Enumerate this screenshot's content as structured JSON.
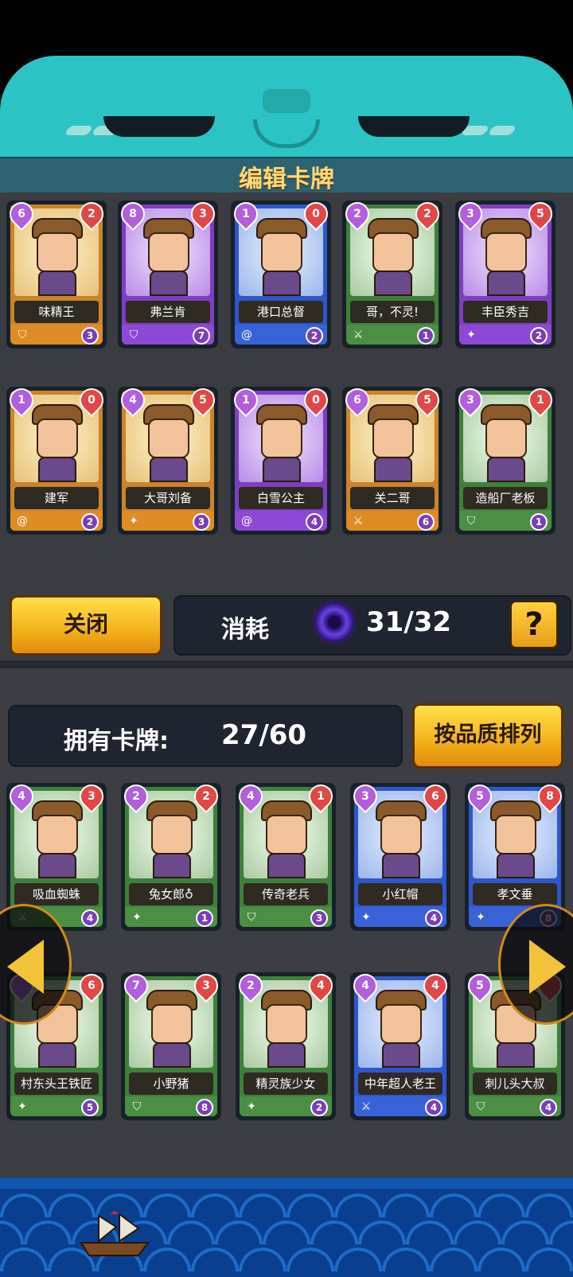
{
  "header": {
    "title": "编辑卡牌"
  },
  "deck": {
    "cards": [
      {
        "name": "味精王",
        "cost": "6",
        "attack": "2",
        "level": "3",
        "rarity": "orange",
        "type_icon": "shield-icon"
      },
      {
        "name": "弗兰肯",
        "cost": "8",
        "attack": "3",
        "level": "7",
        "rarity": "purple",
        "type_icon": "shield-icon"
      },
      {
        "name": "港口总督",
        "cost": "1",
        "attack": "0",
        "level": "2",
        "rarity": "blue",
        "type_icon": "swirl-icon"
      },
      {
        "name": "哥，不灵!",
        "cost": "2",
        "attack": "2",
        "level": "1",
        "rarity": "green",
        "type_icon": "sword-icon"
      },
      {
        "name": "丰臣秀吉",
        "cost": "3",
        "attack": "5",
        "level": "2",
        "rarity": "purple",
        "type_icon": "shuriken-icon"
      },
      {
        "name": "建军",
        "cost": "1",
        "attack": "0",
        "level": "2",
        "rarity": "orange",
        "type_icon": "swirl-icon"
      },
      {
        "name": "大哥刘备",
        "cost": "4",
        "attack": "5",
        "level": "3",
        "rarity": "orange",
        "type_icon": "shuriken-icon"
      },
      {
        "name": "白雪公主",
        "cost": "1",
        "attack": "0",
        "level": "4",
        "rarity": "purple",
        "type_icon": "swirl-icon"
      },
      {
        "name": "关二哥",
        "cost": "6",
        "attack": "5",
        "level": "6",
        "rarity": "orange",
        "type_icon": "sword-icon"
      },
      {
        "name": "造船厂老板",
        "cost": "3",
        "attack": "1",
        "level": "1",
        "rarity": "green",
        "type_icon": "shield-icon"
      }
    ]
  },
  "controls": {
    "close_label": "关闭",
    "cost_label": "消耗",
    "cost_value": "31/32",
    "help_label": "?"
  },
  "collection": {
    "owned_label": "拥有卡牌:",
    "owned_value": "27/60",
    "sort_label": "按品质排列",
    "cards": [
      {
        "name": "吸血蜘蛛",
        "cost": "4",
        "attack": "3",
        "level": "4",
        "rarity": "green",
        "type_icon": "sword-icon"
      },
      {
        "name": "兔女郎♁",
        "cost": "2",
        "attack": "2",
        "level": "1",
        "rarity": "green",
        "type_icon": "shuriken-icon"
      },
      {
        "name": "传奇老兵",
        "cost": "4",
        "attack": "1",
        "level": "3",
        "rarity": "green",
        "type_icon": "shield-icon"
      },
      {
        "name": "小红帽",
        "cost": "3",
        "attack": "6",
        "level": "4",
        "rarity": "blue",
        "type_icon": "shuriken-icon"
      },
      {
        "name": "孝文垂",
        "cost": "5",
        "attack": "8",
        "level": "8",
        "rarity": "blue",
        "type_icon": "shuriken-icon"
      },
      {
        "name": "村东头王铁匠",
        "cost": "",
        "attack": "6",
        "level": "5",
        "rarity": "green",
        "type_icon": "shuriken-icon"
      },
      {
        "name": "小野猪",
        "cost": "7",
        "attack": "3",
        "level": "8",
        "rarity": "green",
        "type_icon": "shield-icon"
      },
      {
        "name": "精灵族少女",
        "cost": "2",
        "attack": "4",
        "level": "2",
        "rarity": "green",
        "type_icon": "shuriken-icon"
      },
      {
        "name": "中年超人老王",
        "cost": "4",
        "attack": "4",
        "level": "4",
        "rarity": "blue",
        "type_icon": "sword-icon"
      },
      {
        "name": "刺儿头大叔",
        "cost": "5",
        "attack": "",
        "level": "4",
        "rarity": "green",
        "type_icon": "shield-icon"
      }
    ]
  },
  "colors": {
    "teal": "#2bc3c3",
    "gold": "#f2b11a",
    "panel": "#3a3c41",
    "sea": "#0a3f8f"
  }
}
